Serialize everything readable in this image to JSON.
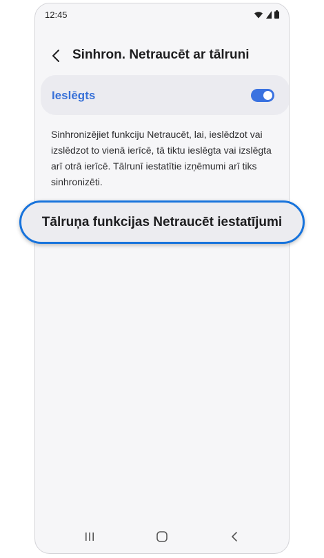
{
  "status": {
    "time": "12:45",
    "icons": [
      "wifi-icon",
      "signal-icon",
      "battery-icon"
    ]
  },
  "header": {
    "back_icon": "chevron-left-icon",
    "title": "Sinhron. Netraucēt ar tālruni"
  },
  "toggle": {
    "label": "Ieslēgts",
    "state": "on"
  },
  "description": "Sinhronizējiet funkciju Netraucēt, lai, ieslēdzot vai izslēdzot to vienā ierīcē, tā tiktu ieslēgta vai izslēgta arī otrā ierīcē. Tālrunī iestatītie izņēmumi arī tiks sinhronizēti.",
  "highlight": {
    "label": "Tālruņa funkcijas Netraucēt iestatījumi"
  },
  "nav": {
    "icons": [
      "recent-apps-icon",
      "home-icon",
      "back-nav-icon"
    ]
  },
  "colors": {
    "accent": "#3a72e0",
    "highlight_border": "#1773dc",
    "card_bg": "#ebebf0",
    "screen_bg": "#f6f6f8"
  }
}
